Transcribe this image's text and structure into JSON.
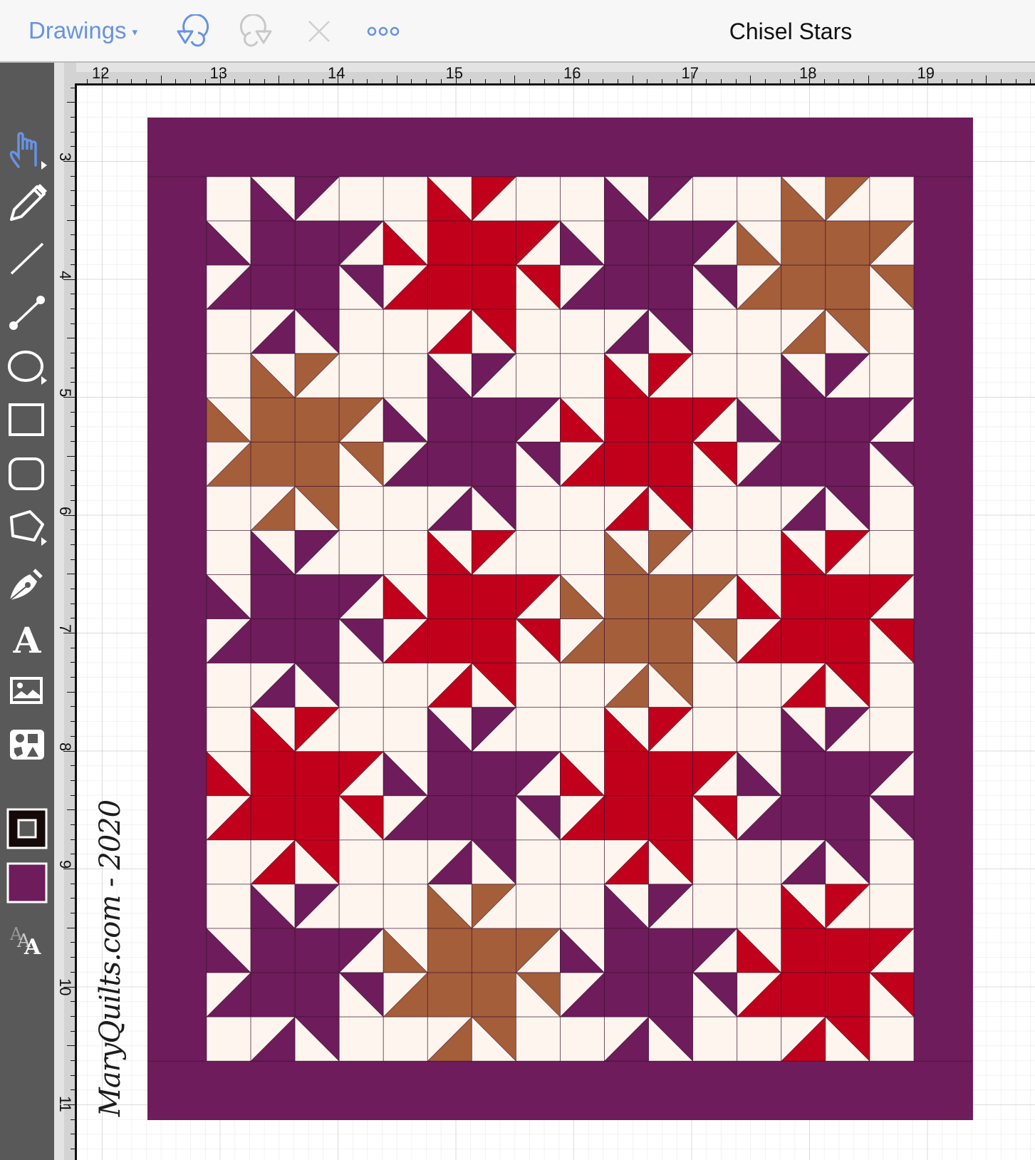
{
  "toolbar": {
    "drawings_label": "Drawings",
    "caret": "▾",
    "icons": [
      "undo-icon",
      "redo-icon",
      "close-icon",
      "more-icon"
    ],
    "title": "Chisel Stars"
  },
  "tools": [
    "hand-tool",
    "pencil-tool",
    "line-tool",
    "connector-tool",
    "ellipse-tool",
    "rectangle-tool",
    "rounded-rectangle-tool",
    "polygon-tool",
    "pen-tool",
    "text-tool",
    "image-tool",
    "shapes-library-tool",
    "stroke-color",
    "fill-color",
    "font-size-tool"
  ],
  "colors": {
    "accent": "#6693e3",
    "fill_swatch": "#6e1c5b"
  },
  "ruler": {
    "x_labels": [
      "12",
      "13",
      "14",
      "15",
      "16",
      "17",
      "18",
      "19"
    ],
    "y_labels": [
      "3",
      "4",
      "5",
      "6",
      "7",
      "8",
      "9",
      "10",
      "11"
    ]
  },
  "quilt": {
    "palette": {
      "purple": "#6e1c5b",
      "red": "#c1001b",
      "brown": "#a55e3a",
      "cream": "#fdf5ee"
    },
    "border_color": "purple",
    "blocks": [
      [
        "purple",
        "red",
        "purple",
        "brown"
      ],
      [
        "brown",
        "purple",
        "red",
        "purple"
      ],
      [
        "purple",
        "red",
        "brown",
        "red"
      ],
      [
        "red",
        "purple",
        "red",
        "purple"
      ],
      [
        "purple",
        "brown",
        "purple",
        "red"
      ]
    ]
  },
  "watermark": "MaryQuilts.com - 2020"
}
